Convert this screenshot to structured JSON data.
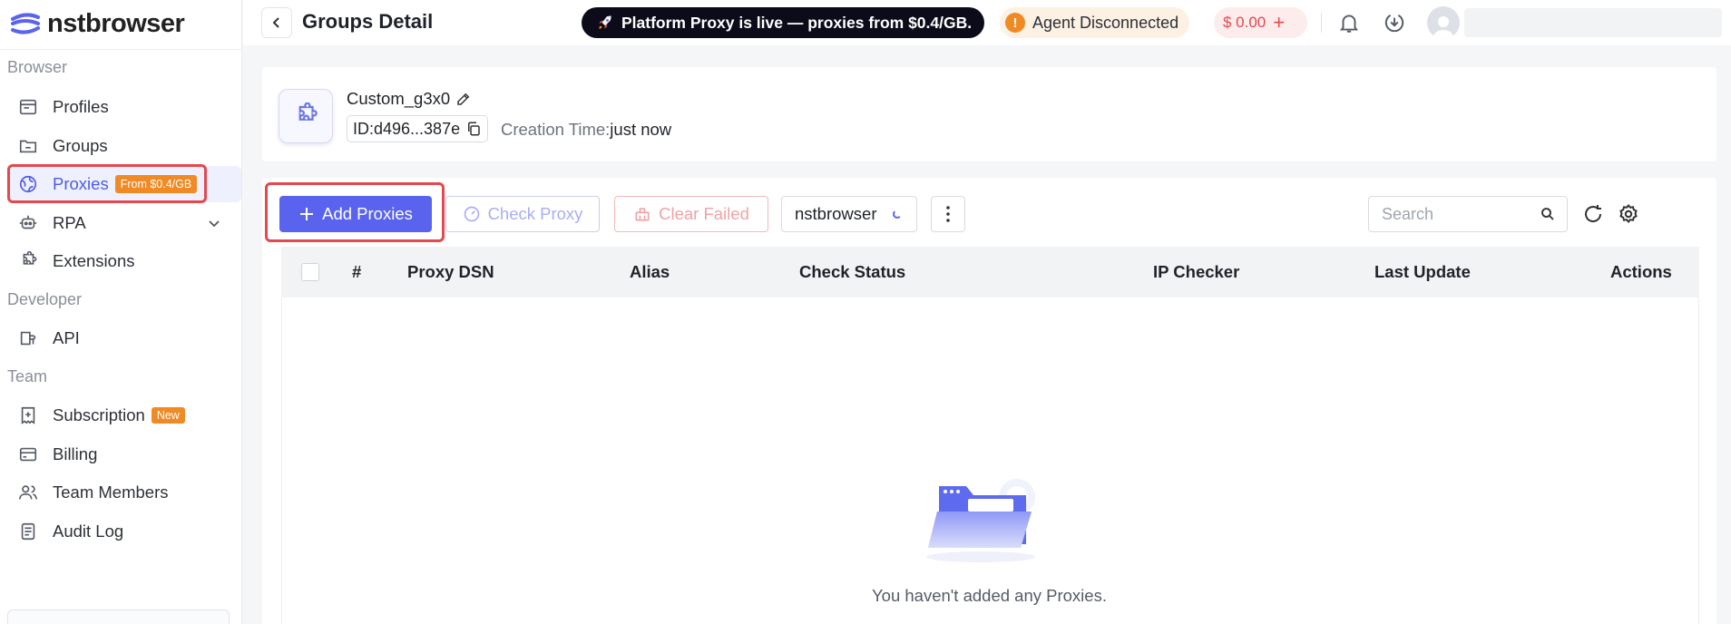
{
  "app": {
    "logo_text": "nstbrowser"
  },
  "sidebar": {
    "sections": {
      "browser": "Browser",
      "developer": "Developer",
      "team": "Team"
    },
    "items": {
      "profiles": "Profiles",
      "groups": "Groups",
      "proxies": "Proxies",
      "proxies_badge": "From $0.4/GB",
      "rpa": "RPA",
      "extensions": "Extensions",
      "api": "API",
      "subscription": "Subscription",
      "subscription_badge": "New",
      "billing": "Billing",
      "team_members": "Team Members",
      "audit_log": "Audit Log"
    }
  },
  "header": {
    "title": "Groups Detail",
    "promo_text": "Platform Proxy is live — proxies from $0.4/GB.",
    "agent_status": "Agent Disconnected",
    "balance": "$ 0.00",
    "balance_plus": "+"
  },
  "group": {
    "name": "Custom_g3x0",
    "id": "ID:d496...387e",
    "creation_label": "Creation Time:",
    "creation_value": "just now"
  },
  "toolbar": {
    "add_proxies": "Add Proxies",
    "check_proxy": "Check Proxy",
    "clear_failed": "Clear Failed",
    "source_select": "nstbrowser",
    "search_placeholder": "Search"
  },
  "table": {
    "columns": [
      "#",
      "Proxy DSN",
      "Alias",
      "Check Status",
      "IP Checker",
      "Last Update",
      "Actions"
    ],
    "empty_text": "You haven't added any Proxies."
  },
  "colors": {
    "primary": "#5a63ee",
    "danger": "#e5484d",
    "badge": "#f08a24"
  }
}
